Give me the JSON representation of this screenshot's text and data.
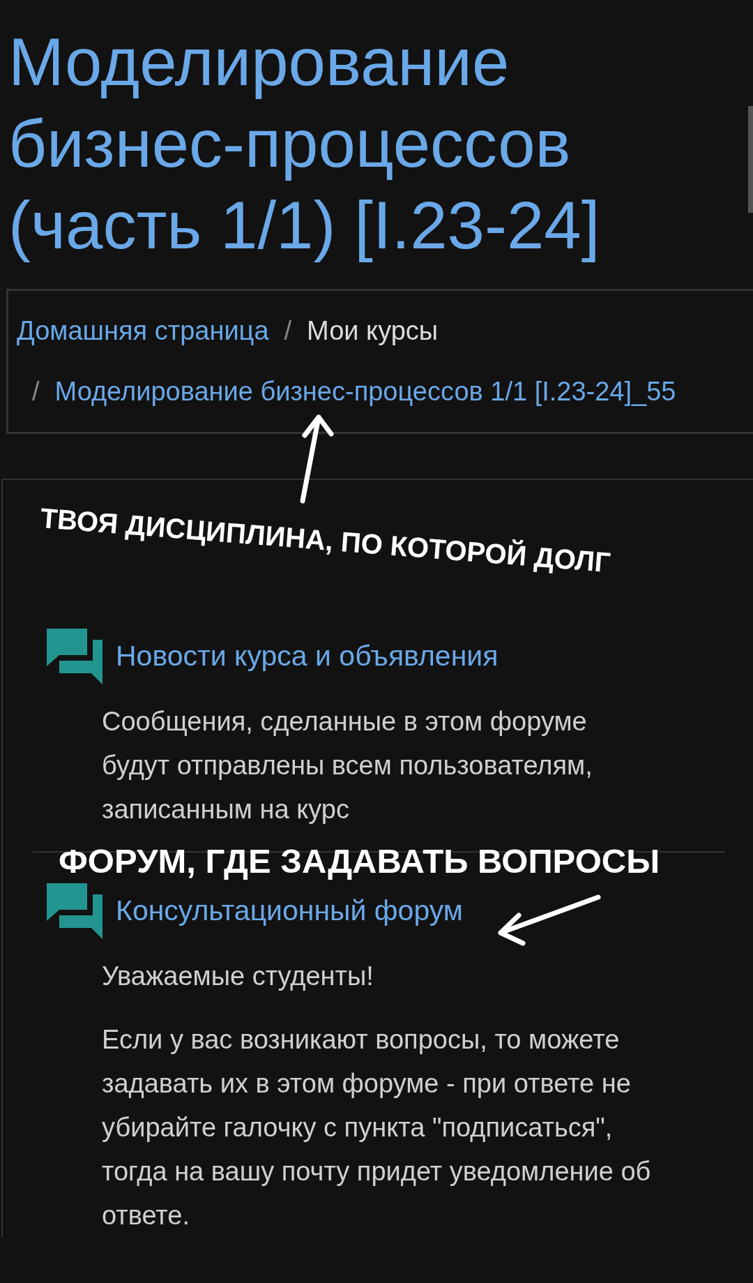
{
  "page_title": "Моделирование бизнес-процессов (часть 1/1) [I.23-24]",
  "breadcrumb": [
    {
      "label": "Домашняя страница",
      "kind": "link"
    },
    {
      "separator": "/",
      "label": "Мои курсы",
      "kind": "text"
    },
    {
      "separator": "/",
      "label": "Моделирование бизнес-процессов 1/1 [I.23-24]_55",
      "kind": "link"
    }
  ],
  "annotations": [
    {
      "text": "ТВОЯ ДИСЦИПЛИНА, ПО КОТОРОЙ ДОЛГ"
    },
    {
      "text": "ФОРУМ, ГДЕ ЗАДАВАТЬ ВОПРОСЫ"
    }
  ],
  "activities": [
    {
      "title": "Новости курса и объявления",
      "description": [
        "Сообщения, сделанные в этом форуме будут отправлены всем пользователям, записанным на курс"
      ]
    },
    {
      "title": "Консультационный форум",
      "description": [
        "Уважаемые студенты!",
        "Если у вас возникают вопросы, то можете задавать их в этом форуме - при ответе не убирайте галочку с пункта \"подписаться\", тогда на вашу почту придет уведомление об ответе."
      ]
    }
  ]
}
